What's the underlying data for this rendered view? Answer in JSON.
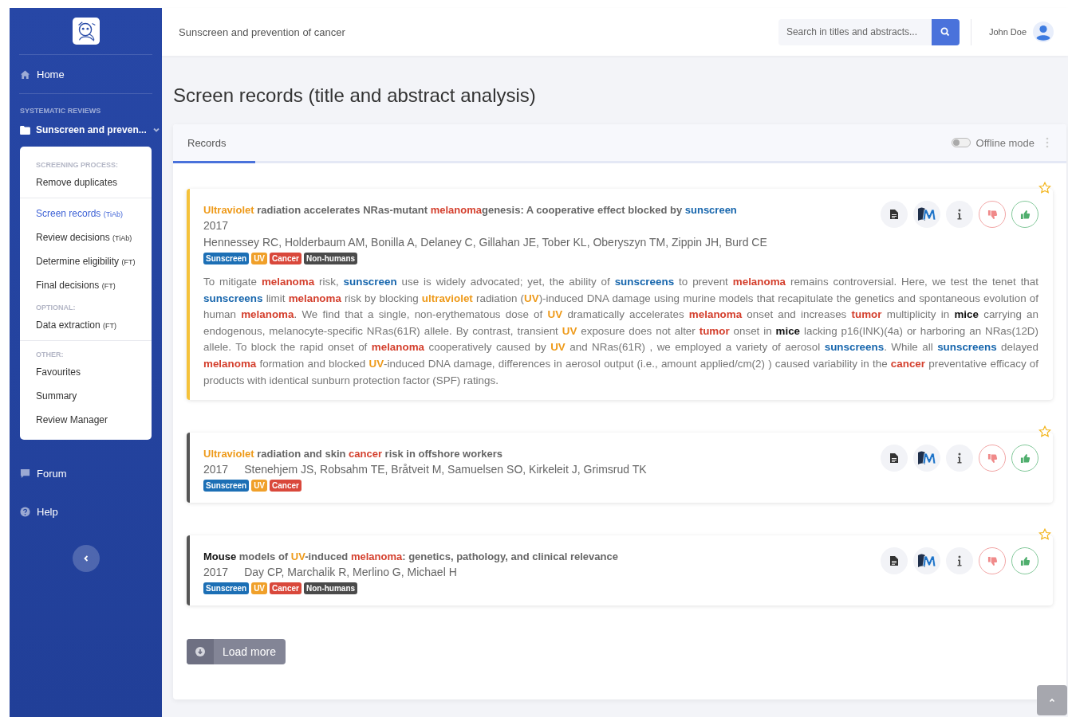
{
  "sidebar": {
    "home": {
      "label": "Home"
    },
    "section_label": "SYSTEMATIC REVIEWS",
    "review": {
      "label": "Sunscreen and preven...",
      "expanded": true
    },
    "submenu": [
      [
        {
          "kind": "heading",
          "label": "SCREENING PROCESS:"
        },
        {
          "kind": "link",
          "label": "Remove duplicates",
          "selected": false
        }
      ],
      [
        {
          "kind": "link",
          "label": "Screen records",
          "note": "(TiAb)",
          "selected": true
        },
        {
          "kind": "link",
          "label": "Review decisions",
          "note": "(TiAb)",
          "selected": false
        },
        {
          "kind": "link",
          "label": "Determine eligibility",
          "note": "(FT)",
          "selected": false
        },
        {
          "kind": "link",
          "label": "Final decisions",
          "note": "(FT)",
          "selected": false
        },
        {
          "kind": "heading",
          "label": "OPTIONAL:"
        },
        {
          "kind": "link",
          "label": "Data extraction",
          "note": "(FT)",
          "selected": false
        }
      ],
      [
        {
          "kind": "heading",
          "label": "OTHER:"
        },
        {
          "kind": "link",
          "label": "Favourites",
          "selected": false
        },
        {
          "kind": "link",
          "label": "Summary",
          "selected": false
        },
        {
          "kind": "link",
          "label": "Review Manager",
          "selected": false
        }
      ]
    ],
    "forum": {
      "label": "Forum"
    },
    "help": {
      "label": "Help"
    }
  },
  "topbar": {
    "breadcrumb": "Sunscreen and prevention of cancer",
    "search": {
      "placeholder": "Search in titles and abstracts..."
    },
    "user": "John Doe"
  },
  "page_title": "Screen records (title and abstract analysis)",
  "panel": {
    "tabs": [
      {
        "label": "Records",
        "selected": true
      }
    ],
    "offline_mode": {
      "label": "Offline mode",
      "on": false
    }
  },
  "records": [
    {
      "selected": true,
      "title": [
        {
          "kind": "uv",
          "t": "Ultraviolet"
        },
        {
          "kind": "text",
          "t": " radiation accelerates NRas-mutant "
        },
        {
          "kind": "cancer",
          "t": "melanoma"
        },
        {
          "kind": "text",
          "t": "genesis: A cooperative effect blocked by "
        },
        {
          "kind": "sunscreen",
          "t": "sunscreen"
        }
      ],
      "year": "2017",
      "authors": "Hennessey RC, Holderbaum AM, Bonilla A, Delaney C, Gillahan JE, Tober KL, Oberyszyn TM, Zippin JH, Burd CE",
      "tags": [
        {
          "label": "Sunscreen",
          "color": "#1c6fb5"
        },
        {
          "label": "UV",
          "color": "#f0a02a"
        },
        {
          "label": "Cancer",
          "color": "#d9483b"
        },
        {
          "label": "Non-humans",
          "color": "#4a4a4a"
        }
      ],
      "abstract": [
        {
          "kind": "text",
          "t": "To mitigate "
        },
        {
          "kind": "cancer",
          "t": "melanoma"
        },
        {
          "kind": "text",
          "t": " risk, "
        },
        {
          "kind": "sunscreen",
          "t": "sunscreen"
        },
        {
          "kind": "text",
          "t": " use is widely advocated; yet, the ability of "
        },
        {
          "kind": "sunscreen",
          "t": "sunscreens"
        },
        {
          "kind": "text",
          "t": " to prevent "
        },
        {
          "kind": "cancer",
          "t": "melanoma"
        },
        {
          "kind": "text",
          "t": " remains controversial. Here, we test the tenet that "
        },
        {
          "kind": "sunscreen",
          "t": "sunscreens"
        },
        {
          "kind": "text",
          "t": " limit "
        },
        {
          "kind": "cancer",
          "t": "melanoma"
        },
        {
          "kind": "text",
          "t": " risk by blocking "
        },
        {
          "kind": "uv",
          "t": "ultraviolet"
        },
        {
          "kind": "text",
          "t": " radiation ("
        },
        {
          "kind": "uv",
          "t": "UV"
        },
        {
          "kind": "text",
          "t": ")-induced DNA damage using murine models that recapitulate the genetics and spontaneous evolution of human "
        },
        {
          "kind": "cancer",
          "t": "melanoma"
        },
        {
          "kind": "text",
          "t": ". We find that a single, non-erythematous dose of "
        },
        {
          "kind": "uv",
          "t": "UV"
        },
        {
          "kind": "text",
          "t": " dramatically accelerates "
        },
        {
          "kind": "cancer",
          "t": "melanoma"
        },
        {
          "kind": "text",
          "t": " onset and increases "
        },
        {
          "kind": "cancer",
          "t": "tumor"
        },
        {
          "kind": "text",
          "t": " multiplicity in "
        },
        {
          "kind": "animal",
          "t": "mice"
        },
        {
          "kind": "text",
          "t": " carrying an endogenous, melanocyte-specific NRas(61R) allele. By contrast, transient "
        },
        {
          "kind": "uv",
          "t": "UV"
        },
        {
          "kind": "text",
          "t": " exposure does not alter "
        },
        {
          "kind": "cancer",
          "t": "tumor"
        },
        {
          "kind": "text",
          "t": " onset in "
        },
        {
          "kind": "animal",
          "t": "mice"
        },
        {
          "kind": "text",
          "t": " lacking p16(INK)(4a) or harboring an NRas(12D) allele. To block the rapid onset of "
        },
        {
          "kind": "cancer",
          "t": "melanoma"
        },
        {
          "kind": "text",
          "t": " cooperatively caused by "
        },
        {
          "kind": "uv",
          "t": "UV"
        },
        {
          "kind": "text",
          "t": " and NRas(61R) , we employed a variety of aerosol "
        },
        {
          "kind": "sunscreen",
          "t": "sunscreens"
        },
        {
          "kind": "text",
          "t": ". While all "
        },
        {
          "kind": "sunscreen",
          "t": "sunscreens"
        },
        {
          "kind": "text",
          "t": " delayed "
        },
        {
          "kind": "cancer",
          "t": "melanoma"
        },
        {
          "kind": "text",
          "t": " formation and blocked "
        },
        {
          "kind": "uv",
          "t": "UV"
        },
        {
          "kind": "text",
          "t": "-induced DNA damage, differences in aerosol output (i.e., amount applied/cm(2) ) caused variability in the "
        },
        {
          "kind": "cancer",
          "t": "cancer"
        },
        {
          "kind": "text",
          "t": " preventative efficacy of products with identical sunburn protection factor (SPF) ratings."
        }
      ]
    },
    {
      "selected": false,
      "title": [
        {
          "kind": "uv",
          "t": "Ultraviolet"
        },
        {
          "kind": "text",
          "t": " radiation and skin "
        },
        {
          "kind": "cancer",
          "t": "cancer"
        },
        {
          "kind": "text",
          "t": " risk in offshore workers"
        }
      ],
      "year": "2017",
      "authors": "Stenehjem JS, Robsahm TE, Bråtveit M, Samuelsen SO, Kirkeleit J, Grimsrud TK",
      "tags": [
        {
          "label": "Sunscreen",
          "color": "#1c6fb5"
        },
        {
          "label": "UV",
          "color": "#f0a02a"
        },
        {
          "label": "Cancer",
          "color": "#d9483b"
        }
      ]
    },
    {
      "selected": false,
      "title": [
        {
          "kind": "animal",
          "t": "Mouse"
        },
        {
          "kind": "text",
          "t": " models of "
        },
        {
          "kind": "uv",
          "t": "UV"
        },
        {
          "kind": "text",
          "t": "-induced "
        },
        {
          "kind": "cancer",
          "t": "melanoma"
        },
        {
          "kind": "text",
          "t": ": genetics, pathology, and clinical relevance"
        }
      ],
      "year": "2017",
      "authors": "Day CP, Marchalik R, Merlino G, Michael H",
      "tags": [
        {
          "label": "Sunscreen",
          "color": "#1c6fb5"
        },
        {
          "label": "UV",
          "color": "#f0a02a"
        },
        {
          "label": "Cancer",
          "color": "#d9483b"
        },
        {
          "label": "Non-humans",
          "color": "#4a4a4a"
        }
      ]
    }
  ],
  "load_more": "Load more"
}
